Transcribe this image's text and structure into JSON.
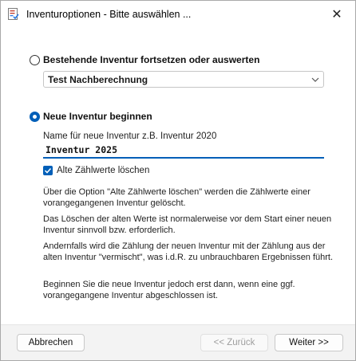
{
  "window": {
    "title": "Inventuroptionen - Bitte auswählen ...",
    "close_glyph": "✕"
  },
  "options": {
    "continue": {
      "label": "Bestehende Inventur fortsetzen oder auswerten",
      "checked": false,
      "selected_inventory": "Test Nachberechnung"
    },
    "new": {
      "label": "Neue Inventur beginnen",
      "checked": true,
      "name_label": "Name für neue Inventur z.B. Inventur 2020",
      "name_value": "Inventur 2025",
      "clear_counts_label": "Alte Zählwerte löschen",
      "clear_counts_checked": true
    }
  },
  "info": {
    "p1": "Über die Option \"Alte Zählwerte löschen\" werden die Zählwerte einer vorangegangenen Inventur gelöscht.",
    "p2": "Das Löschen der alten Werte ist normalerweise vor dem Start einer neuen Inventur sinnvoll bzw. erforderlich.",
    "p3": "Andernfalls wird die Zählung der neuen Inventur mit der Zählung aus der alten Inventur \"vermischt\", was i.d.R. zu unbrauchbaren Ergebnissen führt.",
    "p4": "Beginnen Sie die neue Inventur jedoch erst dann, wenn eine ggf. vorangegangene Inventur abgeschlossen ist."
  },
  "footer": {
    "cancel_label": "Abbrechen",
    "back_label": "<< Zurück",
    "next_label": "Weiter >>"
  },
  "colors": {
    "accent": "#005fb8",
    "footer_bg": "#f3f3f3"
  },
  "icons": {
    "title_icon": "document-checklist-icon",
    "combo_arrow": "chevron-down-icon",
    "check": "checkmark-icon"
  }
}
